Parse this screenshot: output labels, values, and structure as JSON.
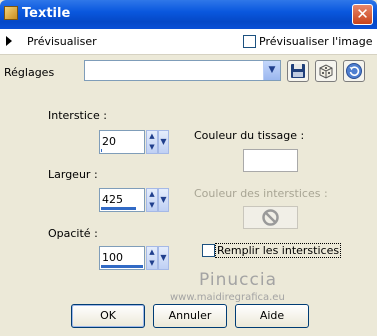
{
  "window": {
    "title": "Textile",
    "close_glyph": "✕"
  },
  "preview": {
    "label": "Prévisualiser",
    "show_image_label": "Prévisualiser l'image",
    "show_image_checked": false
  },
  "settings": {
    "label": "Réglages",
    "value": ""
  },
  "fields": {
    "interstice": {
      "label": "Interstice :",
      "value": "20",
      "level": 0.03
    },
    "largeur": {
      "label": "Largeur :",
      "value": "425",
      "level": 0.83
    },
    "opacite": {
      "label": "Opacité :",
      "value": "100",
      "level": 1.0
    }
  },
  "weave_color": {
    "label": "Couleur du tissage :",
    "color": "#ffffff"
  },
  "gap_color": {
    "label": "Couleur des interstices :",
    "disabled": true
  },
  "fill_gaps": {
    "label": "Remplir les interstices",
    "checked": false
  },
  "watermark": {
    "name": "Pinuccia",
    "url": "www.maidiregrafica.eu"
  },
  "buttons": {
    "ok": "OK",
    "cancel": "Annuler",
    "help": "Aide"
  }
}
